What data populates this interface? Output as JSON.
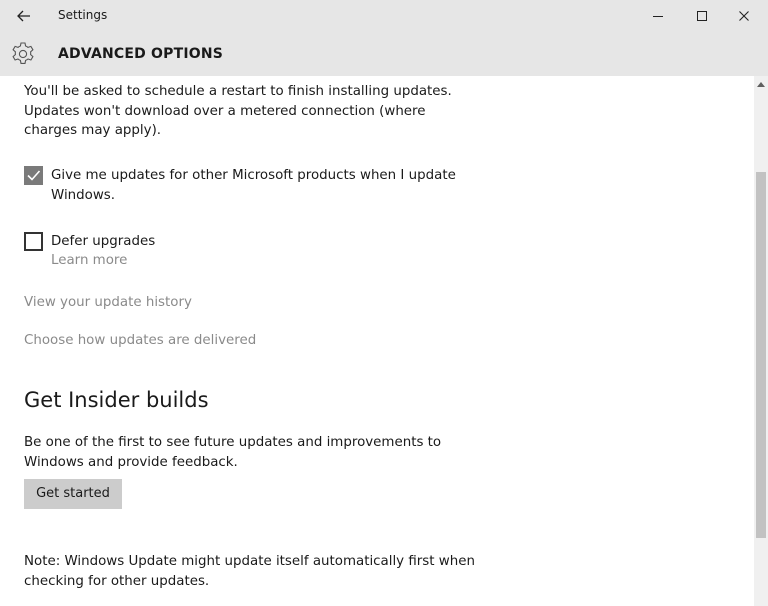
{
  "window": {
    "title": "Settings",
    "controls": {
      "minimize": "minimize",
      "maximize": "maximize",
      "close": "close"
    }
  },
  "header": {
    "title": "ADVANCED OPTIONS",
    "icon": "gear-icon"
  },
  "content": {
    "restart_note_lines": [
      "You'll be asked to schedule a restart to finish installing updates.",
      "Updates won't download over a metered connection (where",
      "charges may apply)."
    ],
    "other_products": {
      "checked": true,
      "label_lines": [
        "Give me updates for other Microsoft products when I update",
        "Windows."
      ]
    },
    "defer": {
      "checked": false,
      "label": "Defer upgrades",
      "learn_more": "Learn more"
    },
    "links": {
      "history": "View your update history",
      "delivery": "Choose how updates are delivered"
    },
    "insider": {
      "heading": "Get Insider builds",
      "description_lines": [
        "Be one of the first to see future updates and improvements to",
        "Windows and provide feedback."
      ],
      "button": "Get started"
    },
    "footnote_lines": [
      "Note: Windows Update might update itself automatically first when",
      "checking for other updates."
    ]
  },
  "colors": {
    "chrome": "#e6e6e6",
    "checkbox_checked": "#7a7a7a",
    "link_gray": "#8a8a8a",
    "button": "#cccccc"
  }
}
